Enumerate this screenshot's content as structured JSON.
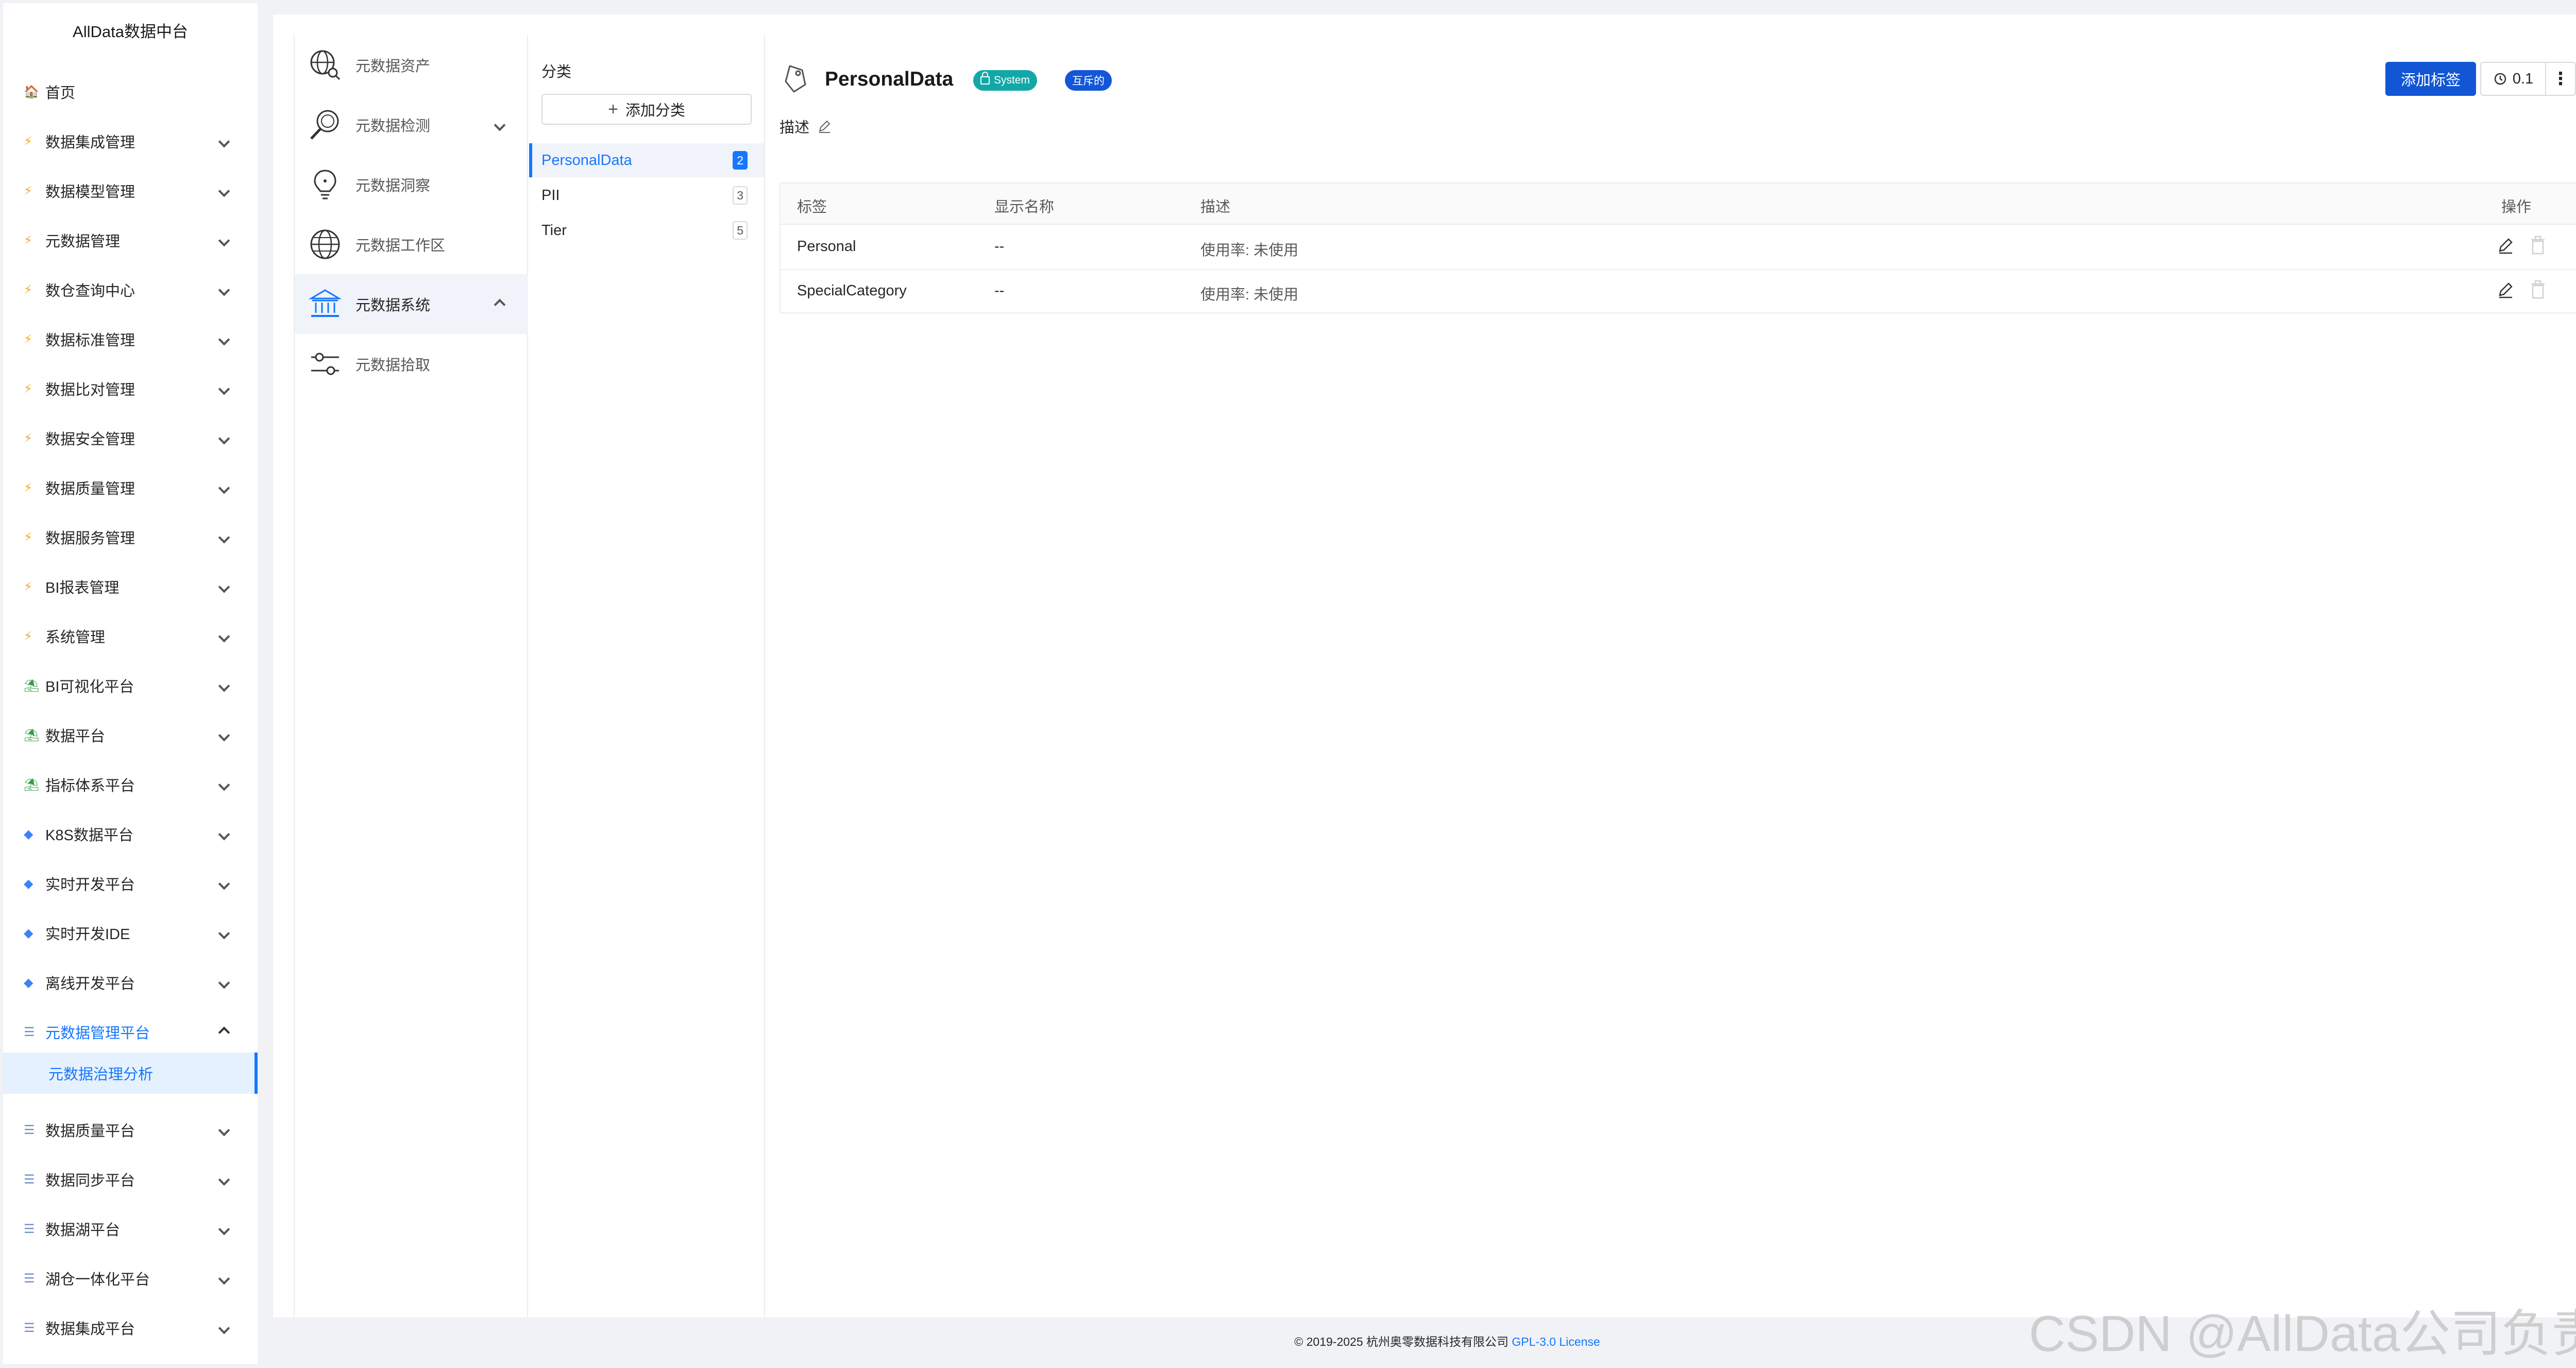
{
  "app": {
    "title": "AllData数据中台"
  },
  "sidebar": {
    "home": "首页",
    "items": [
      {
        "label": "数据集成管理",
        "icon": "bolt-icon"
      },
      {
        "label": "数据模型管理",
        "icon": "bolt-icon"
      },
      {
        "label": "元数据管理",
        "icon": "bolt-icon"
      },
      {
        "label": "数仓查询中心",
        "icon": "bolt-icon"
      },
      {
        "label": "数据标准管理",
        "icon": "bolt-icon"
      },
      {
        "label": "数据比对管理",
        "icon": "bolt-icon"
      },
      {
        "label": "数据安全管理",
        "icon": "bolt-icon"
      },
      {
        "label": "数据质量管理",
        "icon": "bolt-icon"
      },
      {
        "label": "数据服务管理",
        "icon": "bolt-icon"
      },
      {
        "label": "BI报表管理",
        "icon": "bolt-icon"
      },
      {
        "label": "系统管理",
        "icon": "bolt-icon"
      },
      {
        "label": "BI可视化平台",
        "icon": "tree-icon"
      },
      {
        "label": "数据平台",
        "icon": "tree-icon"
      },
      {
        "label": "指标体系平台",
        "icon": "tree-icon"
      },
      {
        "label": "K8S数据平台",
        "icon": "gem-icon"
      },
      {
        "label": "实时开发平台",
        "icon": "gem-icon"
      },
      {
        "label": "实时开发IDE",
        "icon": "gem-icon"
      },
      {
        "label": "离线开发平台",
        "icon": "gem-icon"
      },
      {
        "label": "元数据管理平台",
        "icon": "layers-icon"
      },
      {
        "label": "数据质量平台",
        "icon": "layers-icon"
      },
      {
        "label": "数据同步平台",
        "icon": "layers-icon"
      },
      {
        "label": "数据湖平台",
        "icon": "layers-icon"
      },
      {
        "label": "湖仓一体化平台",
        "icon": "layers-icon"
      },
      {
        "label": "数据集成平台",
        "icon": "layers-icon"
      }
    ],
    "active_sub": "元数据治理分析"
  },
  "nav2": {
    "items": [
      {
        "label": "元数据资产",
        "icon": "globe-search-icon"
      },
      {
        "label": "元数据检测",
        "icon": "magnifier-icon"
      },
      {
        "label": "元数据洞察",
        "icon": "bulb-icon"
      },
      {
        "label": "元数据工作区",
        "icon": "globe-icon"
      },
      {
        "label": "元数据系统",
        "icon": "bank-icon"
      },
      {
        "label": "元数据拾取",
        "icon": "sliders-icon"
      }
    ]
  },
  "categories": {
    "title": "分类",
    "add_label": "添加分类",
    "items": [
      {
        "name": "PersonalData",
        "count": "2"
      },
      {
        "name": "PII",
        "count": "3"
      },
      {
        "name": "Tier",
        "count": "5"
      }
    ]
  },
  "detail": {
    "title": "PersonalData",
    "badge_system": "System",
    "badge_mutex": "互斥的",
    "desc_label": "描述",
    "add_tag_button": "添加标签",
    "version": "0.1",
    "more": "⋮",
    "table": {
      "headers": [
        "标签",
        "显示名称",
        "描述",
        "操作"
      ],
      "rows": [
        {
          "tag": "Personal",
          "display": "--",
          "desc": "使用率: 未使用"
        },
        {
          "tag": "SpecialCategory",
          "display": "--",
          "desc": "使用率: 未使用"
        }
      ]
    }
  },
  "footer": {
    "copyright": "© 2019-2025 杭州奥零数据科技有限公司",
    "license": "GPL-3.0 License"
  },
  "watermark": "CSDN @AllData公司负责人",
  "colors": {
    "accent": "#1677ff",
    "primary_button": "#1256d6",
    "badge_system": "#13a8a8",
    "badge_mutex": "#1456d8"
  }
}
